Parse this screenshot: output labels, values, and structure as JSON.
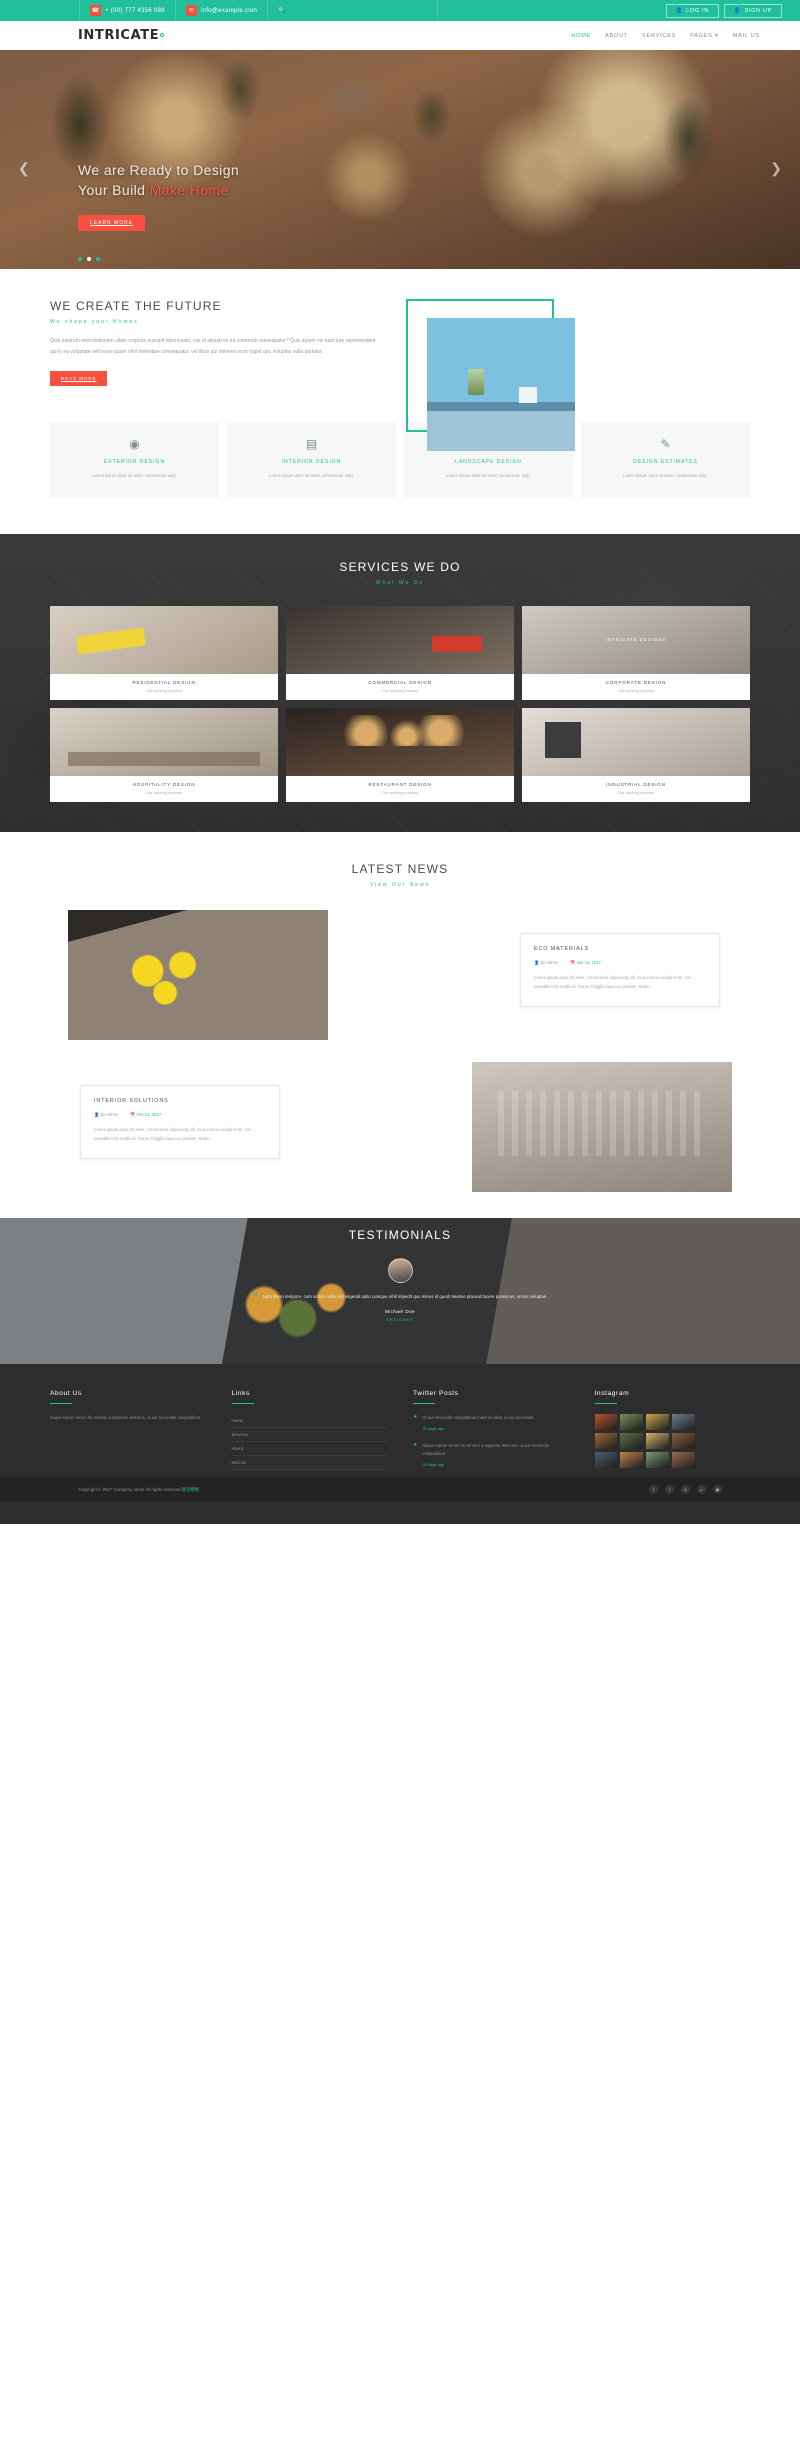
{
  "topbar": {
    "phone": "+ (00) 777 4356 088",
    "email": "info@example.com",
    "phone_icon": "phone-icon",
    "email_icon": "envelope-icon",
    "search_icon": "search-icon",
    "login_label": "LOG IN",
    "signup_label": "SIGN UP",
    "accent": "#21bf9a",
    "icon_bg": "#f8503f"
  },
  "nav": {
    "logo": "INTRICATE",
    "items": [
      {
        "label": "HOME",
        "active": true
      },
      {
        "label": "ABOUT",
        "active": false
      },
      {
        "label": "SERVICES",
        "active": false
      },
      {
        "label": "PAGES ▾",
        "active": false
      },
      {
        "label": "MAIL US",
        "active": false
      }
    ]
  },
  "hero": {
    "title_line1": "We are Ready to Design",
    "title_line2_plain": "Your Build ",
    "title_line2_accent": "Make Home",
    "button": "LEARN MORE",
    "prev_icon": "chevron-left-icon",
    "next_icon": "chevron-right-icon",
    "slide_count": 3,
    "active_slide": 2
  },
  "about": {
    "title": "WE CREATE THE FUTURE",
    "subtitle": "We shape your Homes",
    "paragraph": "Quis nostrum exercitationem ullam corporis suscipit laboriosam, nisi ut aliquid ex ea commodi consequatur? Quis autem vel eum iure reprehenderit qui in ea voluptate velit esse quam nihil molestiae consequatur, vel illum qui dolorem eum fugiat quo voluptas nulla pariatur.",
    "button": "READ MORE"
  },
  "features": [
    {
      "icon": "eye-icon",
      "glyph": "◉",
      "title": "EXTERIOR DESIGN",
      "text": "Lorem ipsum dolor sit amet, consectetur adip."
    },
    {
      "icon": "book-icon",
      "glyph": "▤",
      "title": "INTERIOR DESIGN",
      "text": "Lorem ipsum dolor sit amet, consectetur adip."
    },
    {
      "icon": "leaf-icon",
      "glyph": "❦",
      "title": "LANDSCAPE DESIGN",
      "text": "Lorem ipsum dolor sit amet, consectetur adip."
    },
    {
      "icon": "pencil-icon",
      "glyph": "✎",
      "title": "DESIGN ESTIMATES",
      "text": "Lorem ipsum dolor sit amet, consectetur adip."
    }
  ],
  "services": {
    "title": "SERVICES WE DO",
    "subtitle": "What We Do",
    "overlay_text": "INTRICATE DESIGNS",
    "cards": [
      {
        "title": "RESIDENTIAL DESIGN",
        "text": "Our working process"
      },
      {
        "title": "COMMERCIAL DESIGN",
        "text": "Our working process"
      },
      {
        "title": "CORPORATE DESIGN",
        "text": "Our working process"
      },
      {
        "title": "HOSPITALITY DESIGN",
        "text": "Our working process"
      },
      {
        "title": "RESTAURANT DESIGN",
        "text": "Our working process"
      },
      {
        "title": "INDUSTRIAL DESIGN",
        "text": "Our working process"
      }
    ]
  },
  "news": {
    "title": "LATEST NEWS",
    "subtitle": "View Our News",
    "posts": [
      {
        "title": "ECO MATERIALS",
        "author_icon": "user-icon",
        "author": "By Admin",
        "date_icon": "calendar-icon",
        "date": "Jan 15, 2017",
        "text": "Lorem ipsum dolor sit amet, consectetur adipiscing elit. Cras rutrum iaculis enim, non convallis felis mattis at. Donec fringilla lacus eu pretium rutrum."
      },
      {
        "title": "INTERIOR SOLUTIONS",
        "author_icon": "user-icon",
        "author": "By Admin",
        "date_icon": "calendar-icon",
        "date": "Feb 21, 2017",
        "text": "Lorem ipsum dolor sit amet, consectetur adipiscing elit. Cras rutrum iaculis enim, non convallis felis mattis at. Donec fringilla lacus eu pretium rutrum."
      }
    ]
  },
  "testimonials": {
    "title": "TESTIMONIALS",
    "quote_icon": "quote-icon",
    "quote": "Nam libero tempore, cum soluta nobis est eligendi optio cumque nihil impedit quo minus id quod maxime placeat facere possimus, omnis voluptas.",
    "name": "Michael Doe",
    "role": "DESIGNER"
  },
  "footer": {
    "about": {
      "title": "About Us",
      "text": "Itaque earum rerum hic tenetur a sapiente delectus, ut aut reiciendis voluptatibus."
    },
    "links": {
      "title": "Links",
      "items": [
        "Home",
        "Services",
        "About",
        "Mail Us"
      ]
    },
    "twitter": {
      "title": "Twitter Posts",
      "posts": [
        {
          "icon": "twitter-icon",
          "text": "Ut aut reiciendis voluptatibus maiores alias, et aut reiciendis.",
          "ago": "02 days ago"
        },
        {
          "icon": "twitter-icon",
          "text": "Itaque earum rerum hic tenetur a sapiente delectus, ut aut reiciendis voluptatibus.",
          "ago": "03 days ago"
        }
      ]
    },
    "instagram": {
      "title": "Instagram",
      "tile_count": 12
    },
    "copyright_pre": "Copyright © 2017 Company name All rights reserved.",
    "copyright_accent": "网页模板",
    "socials": [
      {
        "icon": "facebook-icon",
        "glyph": "f"
      },
      {
        "icon": "twitter-icon",
        "glyph": "t"
      },
      {
        "icon": "google-plus-icon",
        "glyph": "G"
      },
      {
        "icon": "pinterest-icon",
        "glyph": "p"
      },
      {
        "icon": "instagram-icon",
        "glyph": "▣"
      }
    ]
  }
}
